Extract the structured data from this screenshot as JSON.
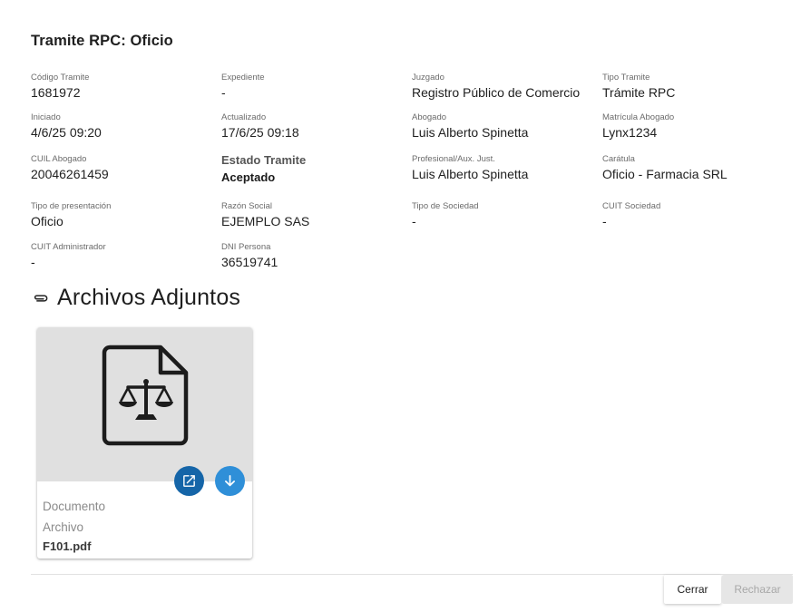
{
  "header": {
    "title": "Tramite RPC: Oficio"
  },
  "fields": {
    "codigo_tramite": {
      "label": "Código Tramite",
      "value": "1681972"
    },
    "expediente": {
      "label": "Expediente",
      "value": "-"
    },
    "juzgado": {
      "label": "Juzgado",
      "value": "Registro Público de Comercio"
    },
    "tipo_tramite": {
      "label": "Tipo Tramite",
      "value": "Trámite RPC"
    },
    "iniciado": {
      "label": "Iniciado",
      "value": "4/6/25 09:20"
    },
    "actualizado": {
      "label": "Actualizado",
      "value": "17/6/25 09:18"
    },
    "abogado": {
      "label": "Abogado",
      "value": "Luis Alberto Spinetta"
    },
    "matricula_abogado": {
      "label": "Matrícula Abogado",
      "value": "Lynx1234"
    },
    "cuil_abogado": {
      "label": "CUIL Abogado",
      "value": "20046261459"
    },
    "estado_tramite": {
      "label": "Estado Tramite",
      "value": "Aceptado"
    },
    "profesional": {
      "label": "Profesional/Aux. Just.",
      "value": "Luis Alberto Spinetta"
    },
    "caratula": {
      "label": "Carátula",
      "value": "Oficio - Farmacia SRL"
    },
    "tipo_presentacion": {
      "label": "Tipo de presentación",
      "value": "Oficio"
    },
    "razon_social": {
      "label": "Razón Social",
      "value": "EJEMPLO SAS"
    },
    "tipo_sociedad": {
      "label": "Tipo de Sociedad",
      "value": "-"
    },
    "cuit_sociedad": {
      "label": "CUIT Sociedad",
      "value": "-"
    },
    "cuit_administrador": {
      "label": "CUIT Administrador",
      "value": "-"
    },
    "dni_persona": {
      "label": "DNI Persona",
      "value": "36519741"
    }
  },
  "attachments": {
    "title": "Archivos Adjuntos",
    "icon": "paperclip-icon",
    "items": [
      {
        "type_label": "Documento",
        "subtype_label": "Archivo",
        "filename": "F101.pdf",
        "icon": "legal-document-icon"
      }
    ]
  },
  "actions": {
    "close_label": "Cerrar",
    "reject_label": "Rechazar"
  },
  "colors": {
    "fab_open": "#1565a8",
    "fab_download": "#2f8fd8",
    "thumb_bg": "#e0e0e0",
    "disabled_bg": "#e6e6e6"
  }
}
